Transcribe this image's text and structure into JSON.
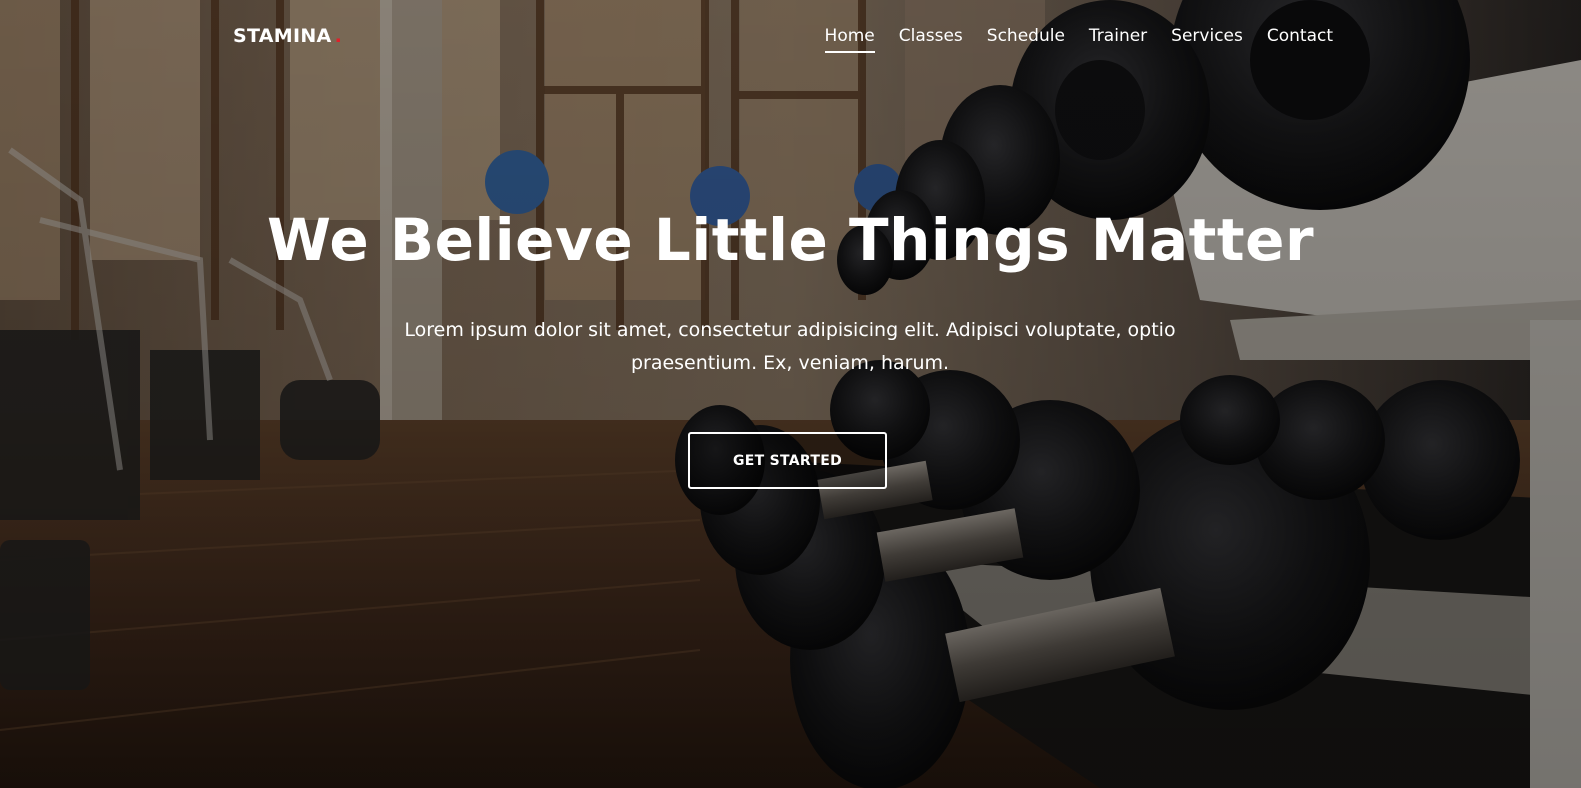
{
  "brand": {
    "name": "STAMINA",
    "dot": "."
  },
  "nav": {
    "items": [
      {
        "label": "Home",
        "active": true
      },
      {
        "label": "Classes",
        "active": false
      },
      {
        "label": "Schedule",
        "active": false
      },
      {
        "label": "Trainer",
        "active": false
      },
      {
        "label": "Services",
        "active": false
      },
      {
        "label": "Contact",
        "active": false
      }
    ]
  },
  "hero": {
    "title": "We Believe Little Things Matter",
    "description": "Lorem ipsum dolor sit amet, consectetur adipisicing elit. Adipisci voluptate, optio praesentium. Ex, veniam, harum.",
    "cta_label": "GET STARTED",
    "background": "gym-dumbbell-rack-photo"
  },
  "colors": {
    "accent": "#e0202a",
    "text": "#ffffff"
  }
}
